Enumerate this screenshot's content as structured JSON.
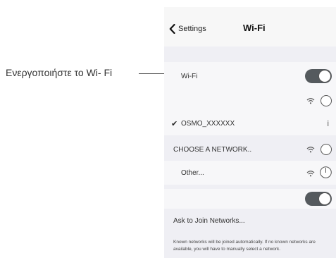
{
  "callout": {
    "text": "Ενεργοποιήστε το Wi- Fi"
  },
  "nav": {
    "back_label": "Settings",
    "title": "Wi-Fi"
  },
  "wifi_row": {
    "label": "Wi-Fi",
    "toggle_on": true
  },
  "connected_network": {
    "name": "OSMO_XXXXXX",
    "info_glyph": "i"
  },
  "choose_network": {
    "label": "CHOOSE A NETWORK.."
  },
  "other_row": {
    "label": "Other..."
  },
  "ask_row": {
    "label": "Ask to Join Networks...",
    "toggle_on": true
  },
  "hint": {
    "text": "Known networks will be joined automatically. If no known networks are available, you will have to manually select a network."
  },
  "icons": [
    "chevron-left-icon",
    "wifi-icon",
    "loading-ring-icon",
    "checkmark-icon",
    "info-icon",
    "power-icon"
  ],
  "colors": {
    "toggle_on": "#555a5e",
    "panel_bg": "#efeff4"
  }
}
